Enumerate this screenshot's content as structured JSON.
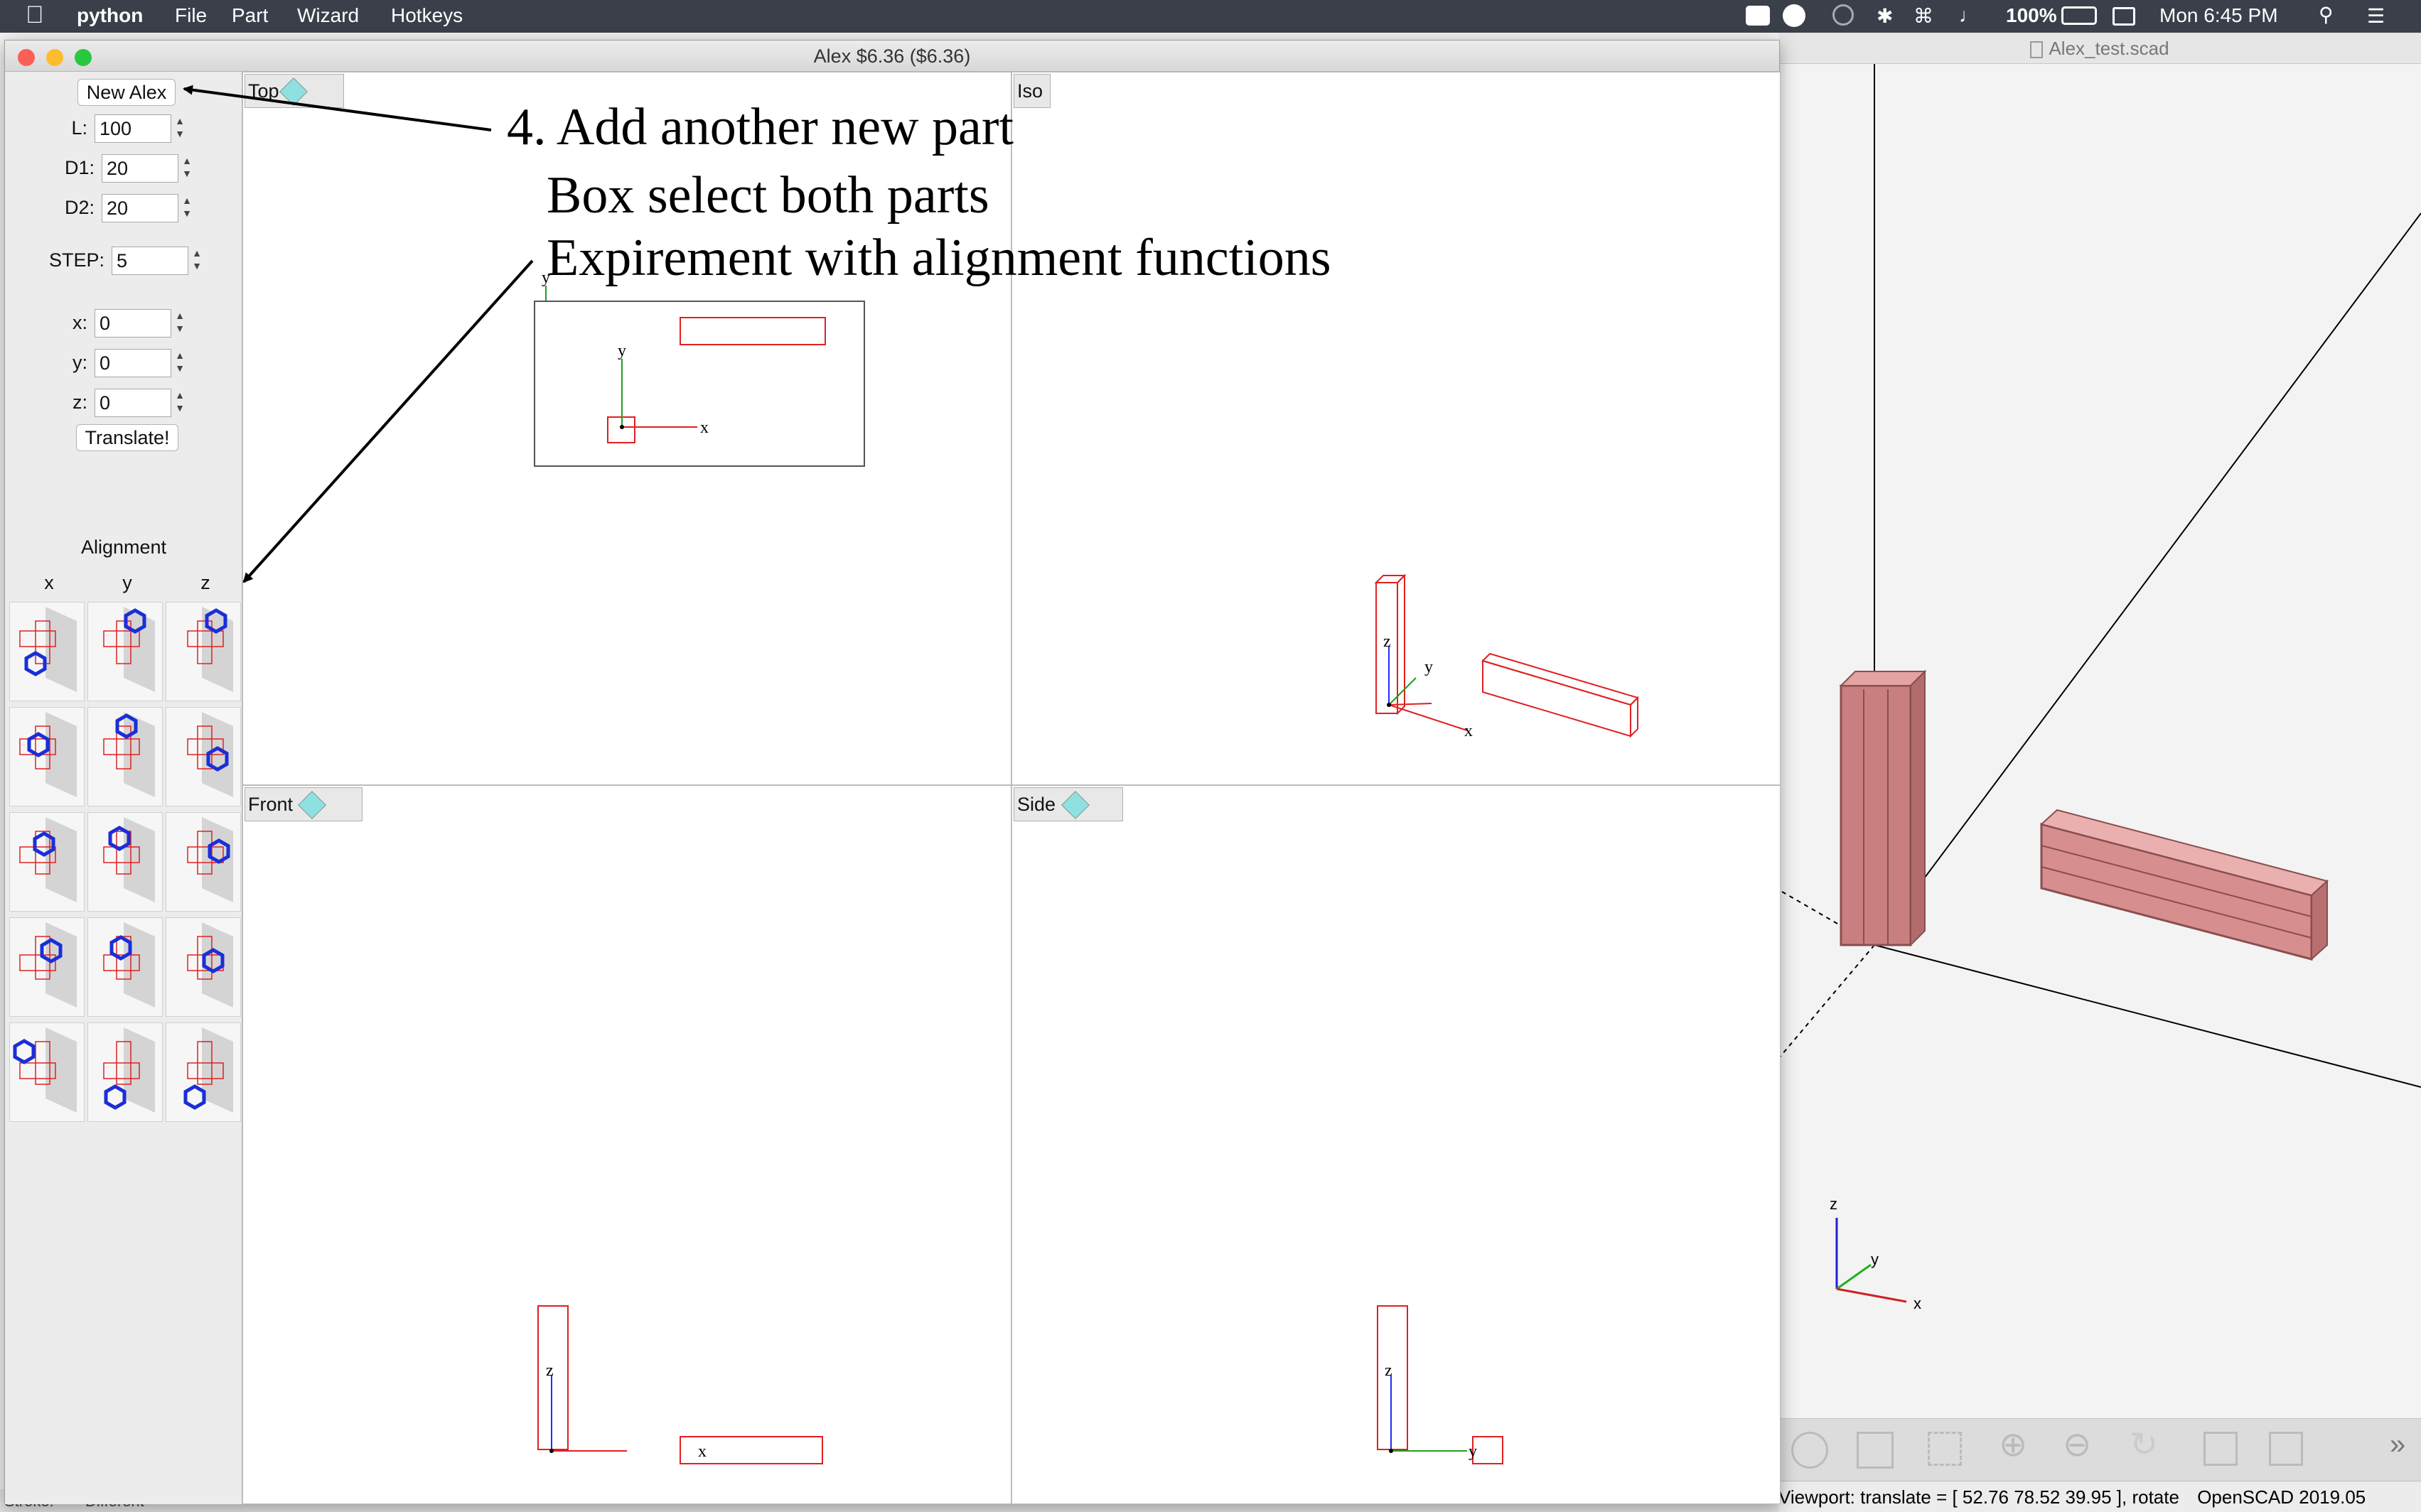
{
  "menubar": {
    "app_name": "python",
    "menus": [
      "File",
      "Part",
      "Wizard",
      "Hotkeys"
    ],
    "battery": "100%",
    "clock": "Mon 6:45 PM"
  },
  "openscad": {
    "title": "Alex_test.scad",
    "status": "Viewport: translate = [ 52.76 78.52 39.95 ], rotate",
    "version": "OpenSCAD 2019.05",
    "axis_x": "x",
    "axis_y": "y",
    "axis_z": "z"
  },
  "window": {
    "title": "Alex  $6.36 ($6.36)"
  },
  "panel": {
    "new_button": "New Alex",
    "L_label": "L:",
    "L_value": "100",
    "D1_label": "D1:",
    "D1_value": "20",
    "D2_label": "D2:",
    "D2_value": "20",
    "STEP_label": "STEP:",
    "STEP_value": "5",
    "x_label": "x:",
    "x_value": "0",
    "y_label": "y:",
    "y_value": "0",
    "z_label": "z:",
    "z_value": "0",
    "translate_button": "Translate!",
    "alignment_title": "Alignment",
    "col_x": "x",
    "col_y": "y",
    "col_z": "z"
  },
  "viewports": {
    "top": "Top",
    "iso": "Iso",
    "front": "Front",
    "side": "Side"
  },
  "axes": {
    "x": "x",
    "y": "y",
    "z": "z"
  },
  "annotation": {
    "line1": "4. Add another new part",
    "line2": "Box select both parts",
    "line3": "Expirement with alignment functions"
  },
  "background_window": {
    "stroke_label": "Stroke:",
    "stroke_value": "Different"
  },
  "colors": {
    "menubar": "#3a3f4a",
    "part_outline": "#e02020",
    "part_fill": "#d98b8b",
    "align_hex": "#1a2ed8"
  }
}
